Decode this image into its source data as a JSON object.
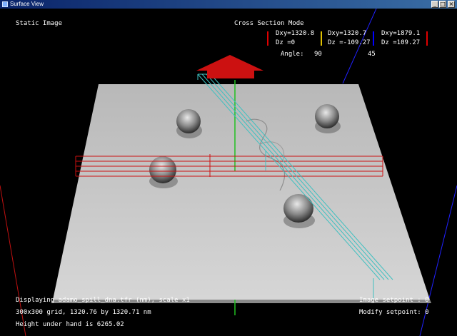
{
  "window": {
    "title": "Surface View",
    "min_glyph": "_",
    "max_glyph": "□",
    "close_glyph": "×"
  },
  "overlay": {
    "mode_left": "Static Image",
    "mode_right": "Cross Section Mode",
    "readouts": [
      {
        "dxy": "Dxy=1320.8",
        "dz": "Dz =0",
        "color": "#e00000"
      },
      {
        "dxy": "Dxy=1320.7",
        "dz": "Dz =-109.27",
        "color": "#e0c000"
      },
      {
        "dxy": "Dxy=1879.1",
        "dz": "Dz =109.27",
        "color": "#0000ff"
      }
    ],
    "angle_label": "Angle:",
    "angle_value_1": "90",
    "angle_value_2": "45",
    "status": {
      "line1": "Displaying adamo_spill_dna.tfr (nm), scale x1",
      "line2": "300x300 grid, 1320.76 by 1320.71 nm",
      "line3": "Height under hand is 6265.02",
      "image_setpoint": "Image setpoint : 0",
      "modify_setpoint": "Modify setpoint: 0"
    }
  },
  "colors": {
    "background": "#000000",
    "surface": "#c8c8c8",
    "red_marker": "#cc1111",
    "cyan_plane": "#3fc0c0",
    "green_axis": "#20c020",
    "blue_axis": "#2020ff"
  }
}
